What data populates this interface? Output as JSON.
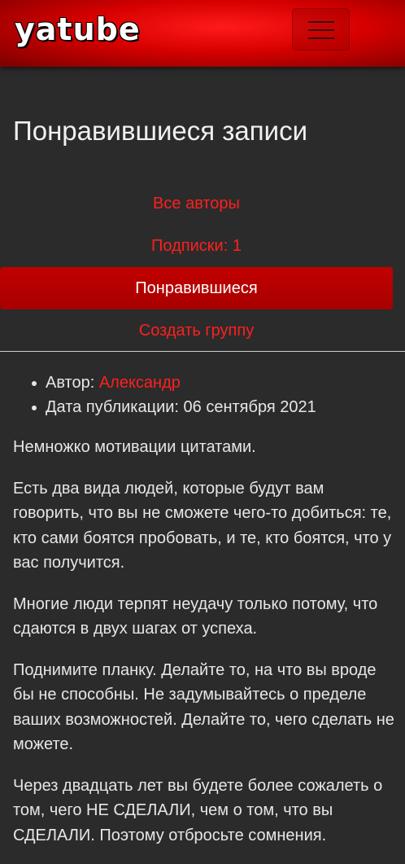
{
  "navbar": {
    "logo": "yatube",
    "menu_icon": "hamburger-menu-icon",
    "brand_color": "#e00000"
  },
  "page": {
    "title": "Понравившиеся записи"
  },
  "tabs": [
    {
      "label": "Все авторы",
      "active": false
    },
    {
      "label": "Подписки: 1",
      "active": false
    },
    {
      "label": "Понравившиеся",
      "active": true
    },
    {
      "label": "Создать группу",
      "active": false
    }
  ],
  "post": {
    "author_label": "Автор: ",
    "author_name": "Александр",
    "date_label": "Дата публикации: ",
    "date_value": "06 сентября 2021",
    "paragraphs": [
      "Немножко мотивации цитатами.",
      "Есть два вида людей, которые будут вам говорить, что вы не сможете чего-то добиться: те, кто сами боятся пробовать, и те, кто боятся, что у вас получится.",
      "Многие люди терпят неудачу только потому, что сдаются в двух шагах от успеха.",
      "Поднимите планку. Делайте то, на что вы вроде бы не способны. Не задумывайтесь о пределе ваших возможностей. Делайте то, чего сделать не можете.",
      "Через двадцать лет вы будете более сожалеть о том, чего НЕ СДЕЛАЛИ, чем о том, что вы СДЕЛАЛИ. Поэтому отбросьте сомнения."
    ]
  },
  "colors": {
    "background": "#2b2b2b",
    "accent": "#ff1f1f",
    "active_tab": "#b80000",
    "text": "#e6e6e6"
  }
}
